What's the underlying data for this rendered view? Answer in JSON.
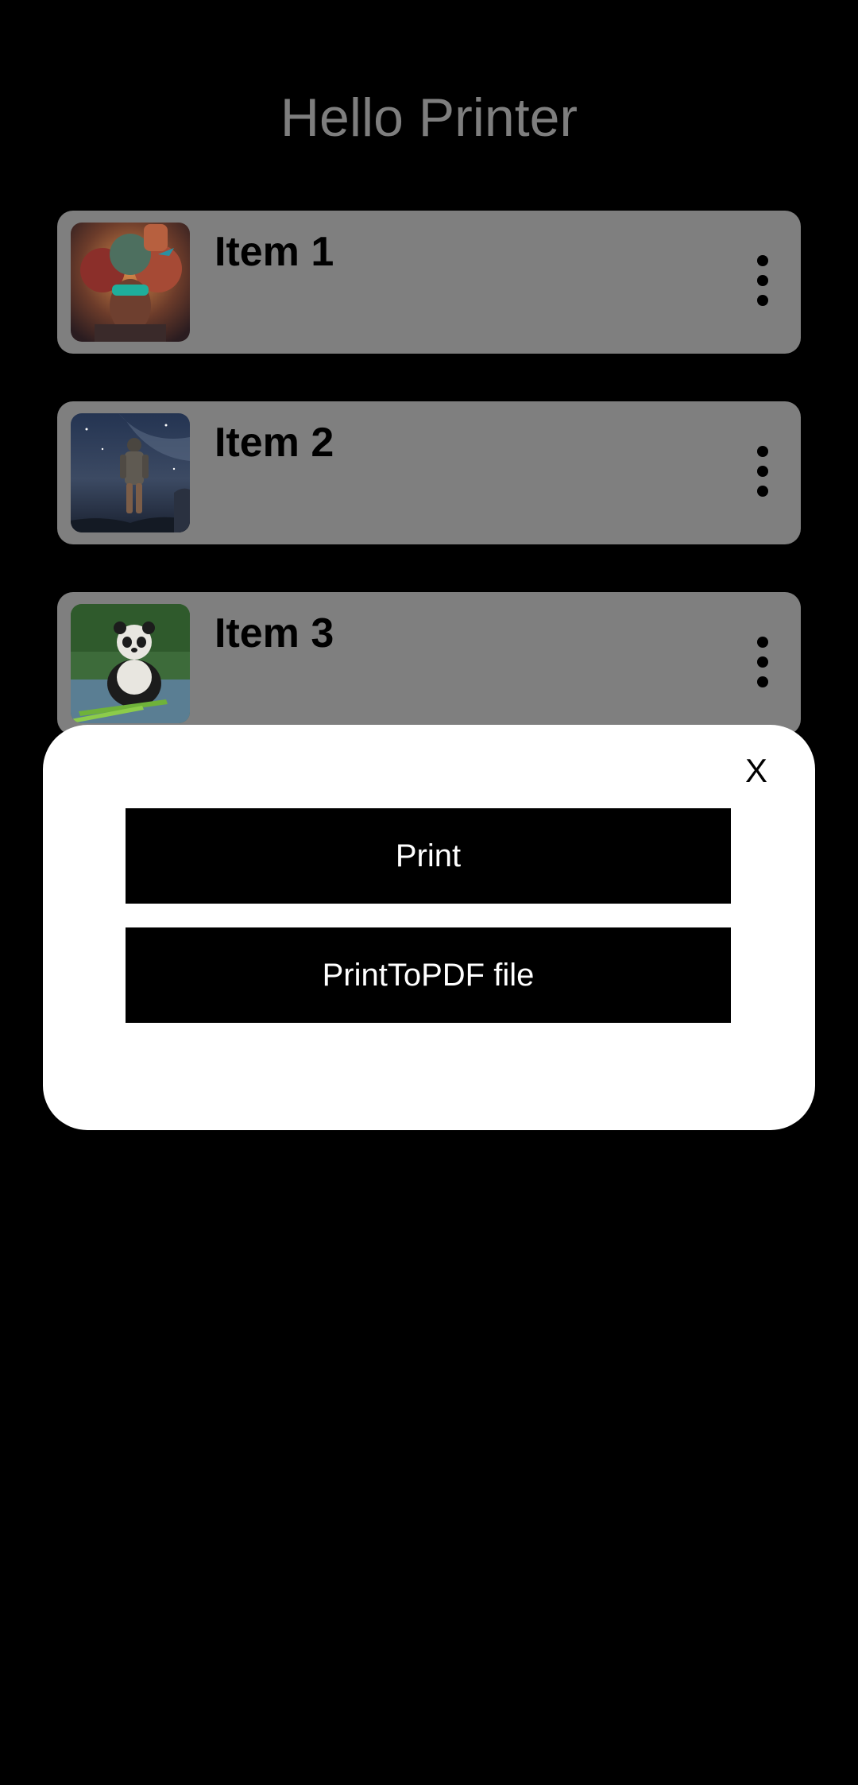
{
  "app": {
    "title": "Hello Printer"
  },
  "items": [
    {
      "label": "Item 1",
      "thumbnail": "woman-with-goggles-collage-image",
      "menu_icon": "more-vert-icon"
    },
    {
      "label": "Item 2",
      "thumbnail": "astronaut-night-sky-image",
      "menu_icon": "more-vert-icon"
    },
    {
      "label": "Item 3",
      "thumbnail": "panda-eating-bamboo-image",
      "menu_icon": "more-vert-icon"
    }
  ],
  "sheet": {
    "close_label": "X",
    "print_label": "Print",
    "print_to_pdf_label": "PrintToPDF file"
  },
  "colors": {
    "background": "#000000",
    "card": "#7f7f7f",
    "title": "#7e7e7e",
    "sheet": "#ffffff",
    "button": "#000000",
    "button_text": "#ffffff"
  }
}
